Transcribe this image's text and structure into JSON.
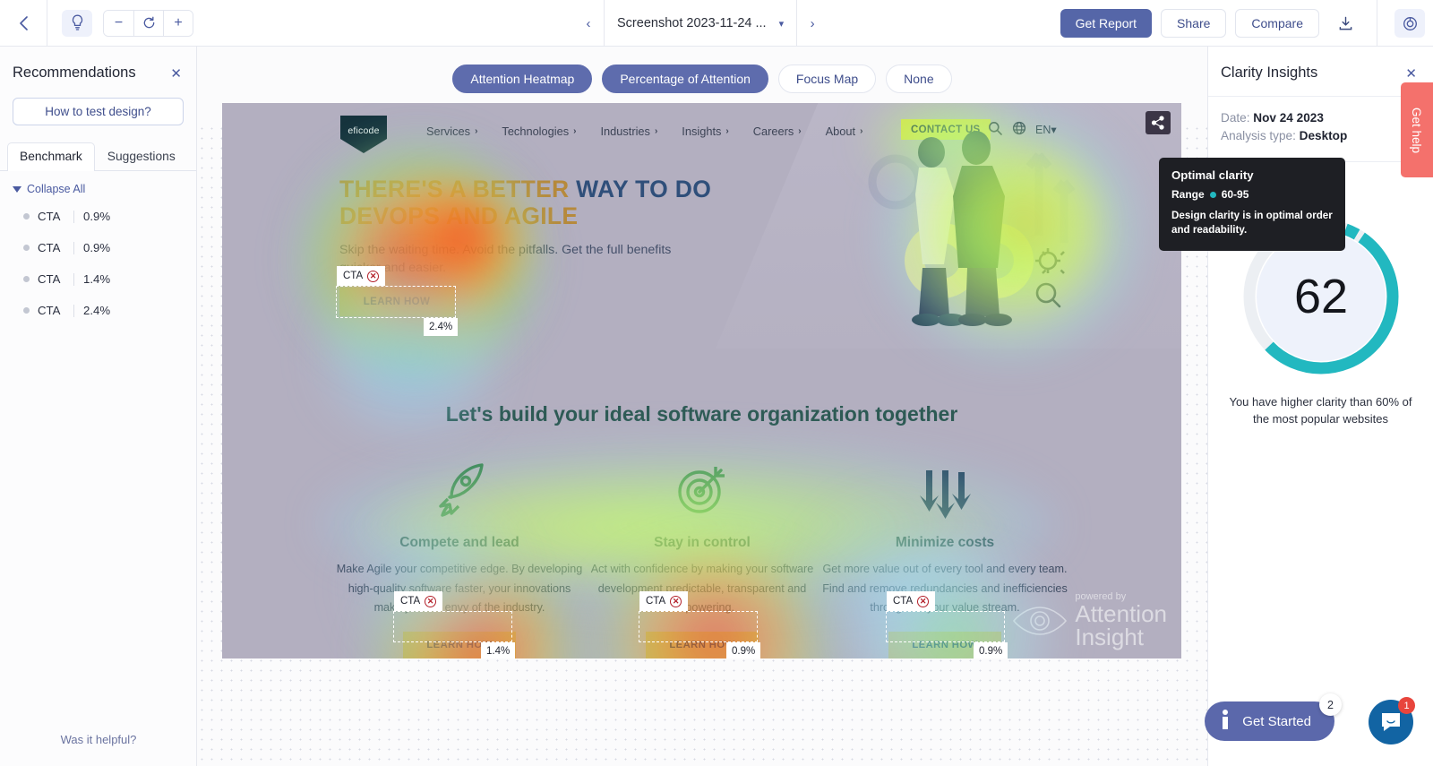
{
  "topbar": {
    "back_icon": "chevron-left-icon",
    "bulb_icon": "lightbulb-icon",
    "zoom_out_label": "−",
    "reset_icon": "reset-rotate-icon",
    "zoom_in_label": "+",
    "prev_label": "‹",
    "next_label": "›",
    "doc_title": "Screenshot 2023-11-24 ...",
    "caret": "▾",
    "get_report": "Get Report",
    "share": "Share",
    "compare": "Compare",
    "download_icon": "download-icon",
    "target_icon": "target-icon"
  },
  "left_panel": {
    "title": "Recommendations",
    "close": "✕",
    "how_to_test": "How to test design?",
    "tabs": [
      {
        "label": "Benchmark",
        "active": true
      },
      {
        "label": "Suggestions",
        "active": false
      }
    ],
    "collapse_all": "Collapse All",
    "items": [
      {
        "label": "CTA",
        "value": "0.9%"
      },
      {
        "label": "CTA",
        "value": "0.9%"
      },
      {
        "label": "CTA",
        "value": "1.4%"
      },
      {
        "label": "CTA",
        "value": "2.4%"
      }
    ],
    "helpful": "Was it helpful?"
  },
  "modes": [
    {
      "label": "Attention Heatmap",
      "on": true
    },
    {
      "label": "Percentage of Attention",
      "on": true
    },
    {
      "label": "Focus Map",
      "on": false
    },
    {
      "label": "None",
      "on": false
    }
  ],
  "screenshot": {
    "logo_text": "eficode",
    "nav_links": [
      "Services",
      "Technologies",
      "Industries",
      "Insights",
      "Careers",
      "About"
    ],
    "contact_us": "CONTACT US",
    "lang": "EN",
    "search_icon": "search-icon",
    "globe_icon": "globe-icon",
    "hero_headline_1": "THERE'S A BETTER ",
    "hero_headline_2": "WAY TO DO",
    "hero_headline_3": "DEVOPS AND AGILE",
    "hero_sub": "Skip the waiting time. Avoid the pitfalls. Get the full benefits quicker and easier.",
    "hero_cta": "LEARN HOW",
    "section_title": "Let's build your ideal software organization together",
    "columns": [
      {
        "icon": "rocket-icon",
        "title": "Compete and lead",
        "body": "Make Agile your competitive edge. By developing high-quality software faster, your innovations make you the envy of the industry.",
        "cta": "LEARN HOW"
      },
      {
        "icon": "target-dart-icon",
        "title": "Stay in control",
        "body": "Act with confidence by making your software development predictable, transparent and empowering.",
        "cta": "LEARN HOW"
      },
      {
        "icon": "down-arrows-icon",
        "title": "Minimize costs",
        "body": "Get more value out of every tool and every team. Find and remove redundancies and inefficiencies throughout your value stream.",
        "cta": "LEARN HOW"
      }
    ],
    "watermark_small": "powered by",
    "watermark_line1": "Attention",
    "watermark_line2": "Insight",
    "graph_icon": "node-graph-icon",
    "cta_markers": [
      {
        "label": "CTA",
        "pct": "2.4%"
      },
      {
        "label": "CTA",
        "pct": "1.4%"
      },
      {
        "label": "CTA",
        "pct": "0.9%"
      },
      {
        "label": "CTA",
        "pct": "0.9%"
      }
    ]
  },
  "right_panel": {
    "title": "Clarity Insights",
    "close": "✕",
    "date_label": "Date:",
    "date_value": "Nov 24 2023",
    "analysis_label": "Analysis type:",
    "analysis_value": "Desktop",
    "score": "62",
    "note": "You have higher clarity than 60% of the most popular websites",
    "get_help": "Get help",
    "accent_color": "#22b8c0"
  },
  "tooltip": {
    "title": "Optimal clarity",
    "range_label": "Range",
    "range_value": "60-95",
    "body": "Design clarity is in optimal order and readability."
  },
  "widgets": {
    "get_started": "Get Started",
    "get_started_badge": "2",
    "chat_badge": "1",
    "info_icon": "info-icon",
    "chat_icon": "chat-bubble-icon"
  }
}
